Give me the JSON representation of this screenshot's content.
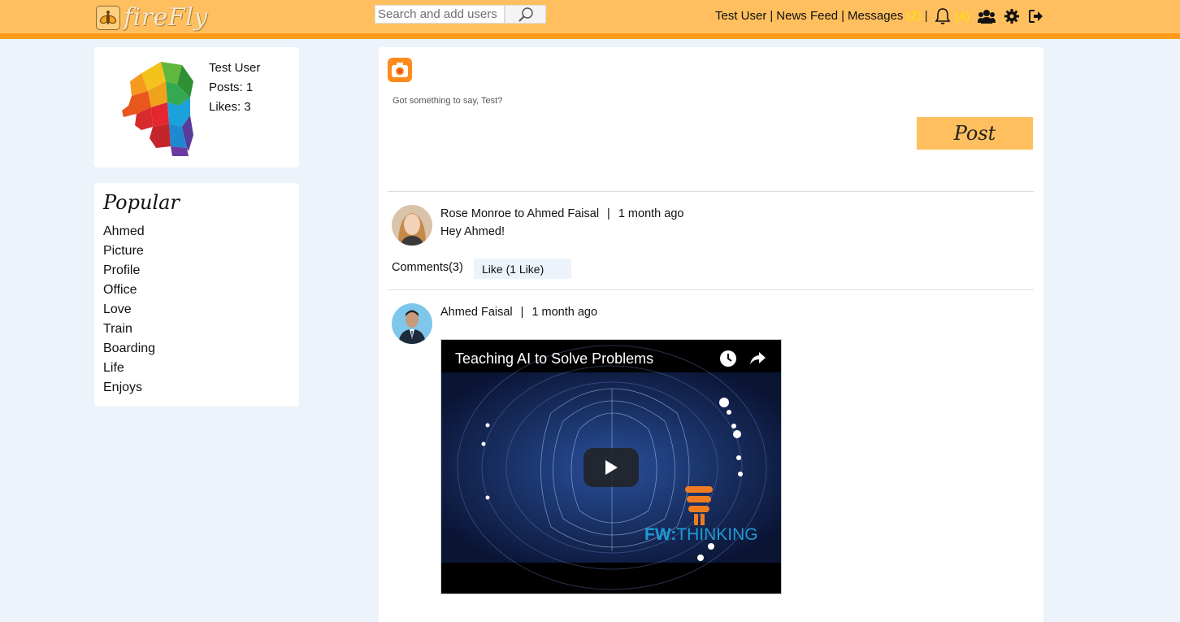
{
  "header": {
    "logo_text": "fireFly",
    "search_placeholder": "Search and add users",
    "nav": {
      "user": "Test User",
      "news_feed": "News Feed",
      "messages": "Messages",
      "messages_count": "(2)",
      "notifications_count": "(4)",
      "separator": "|"
    },
    "icons": [
      "search-icon",
      "bell-icon",
      "users-icon",
      "gear-icon",
      "sign-out-icon"
    ]
  },
  "profile": {
    "name": "Test User",
    "posts": "Posts: 1",
    "likes": "Likes: 3"
  },
  "popular": {
    "title": "Popular",
    "items": [
      "Ahmed",
      "Picture",
      "Profile",
      "Office",
      "Love",
      "Train",
      "Boarding",
      "Life",
      "Enjoys"
    ]
  },
  "composer": {
    "prompt": "Got something to say, Test?",
    "post_label": "Post"
  },
  "posts": [
    {
      "author": "Rose Monroe to Ahmed Faisal",
      "time": "1 month ago",
      "body": "Hey Ahmed!",
      "comments": "Comments(3)",
      "like": "Like (1 Like)"
    },
    {
      "author": "Ahmed Faisal",
      "time": "1 month ago",
      "video": {
        "title": "Teaching AI to Solve Problems",
        "brand_fw": "FW:",
        "brand_thinking": "THINKING"
      }
    }
  ],
  "colors": {
    "header": "#ffbf5e",
    "header_border": "#ff9a1a",
    "background": "#ecf3fb",
    "count": "#ffe600"
  }
}
